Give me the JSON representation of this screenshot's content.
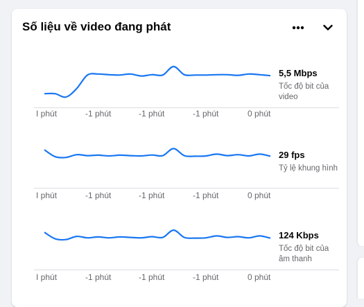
{
  "panel": {
    "title": "Số liệu về video đang phát",
    "more_icon": "more-horizontal-icon",
    "collapse_icon": "chevron-down-icon"
  },
  "colors": {
    "line": "#1877f2",
    "text": "#050505",
    "muted": "#65676b",
    "axis": "#dadde1"
  },
  "charts": [
    {
      "value": "5,5 Mbps",
      "label": "Tốc độ bit của video",
      "ticks": [
        "I phút",
        "-1 phút",
        "-1 phút",
        "-1 phút",
        "0 phút"
      ]
    },
    {
      "value": "29 fps",
      "label": "Tỷ lệ khung hình",
      "ticks": [
        "I phút",
        "-1 phút",
        "-1 phút",
        "-1 phút",
        "0 phút"
      ]
    },
    {
      "value": "124 Kbps",
      "label": "Tốc độ bit của âm thanh",
      "ticks": [
        "I phút",
        "-1 phút",
        "-1 phút",
        "-1 phút",
        "0 phút"
      ]
    }
  ],
  "chart_data": [
    {
      "type": "line",
      "series": [
        {
          "values": [
            0.2,
            0.2,
            0.1,
            0.35,
            0.75,
            0.78,
            0.76,
            0.75,
            0.78,
            0.72,
            0.76,
            0.75,
            1.0,
            0.76,
            0.75,
            0.75,
            0.76,
            0.76,
            0.74,
            0.78,
            0.76,
            0.73
          ]
        }
      ]
    },
    {
      "type": "line",
      "series": [
        {
          "values": [
            0.9,
            0.45,
            0.4,
            0.58,
            0.52,
            0.55,
            0.5,
            0.55,
            0.52,
            0.5,
            0.56,
            0.52,
            0.98,
            0.52,
            0.48,
            0.5,
            0.62,
            0.52,
            0.58,
            0.5,
            0.62,
            0.48
          ]
        }
      ]
    },
    {
      "type": "line",
      "series": [
        {
          "values": [
            0.8,
            0.35,
            0.3,
            0.52,
            0.42,
            0.48,
            0.42,
            0.48,
            0.45,
            0.42,
            0.5,
            0.45,
            0.95,
            0.45,
            0.4,
            0.42,
            0.55,
            0.45,
            0.5,
            0.42,
            0.55,
            0.4
          ]
        }
      ]
    }
  ]
}
